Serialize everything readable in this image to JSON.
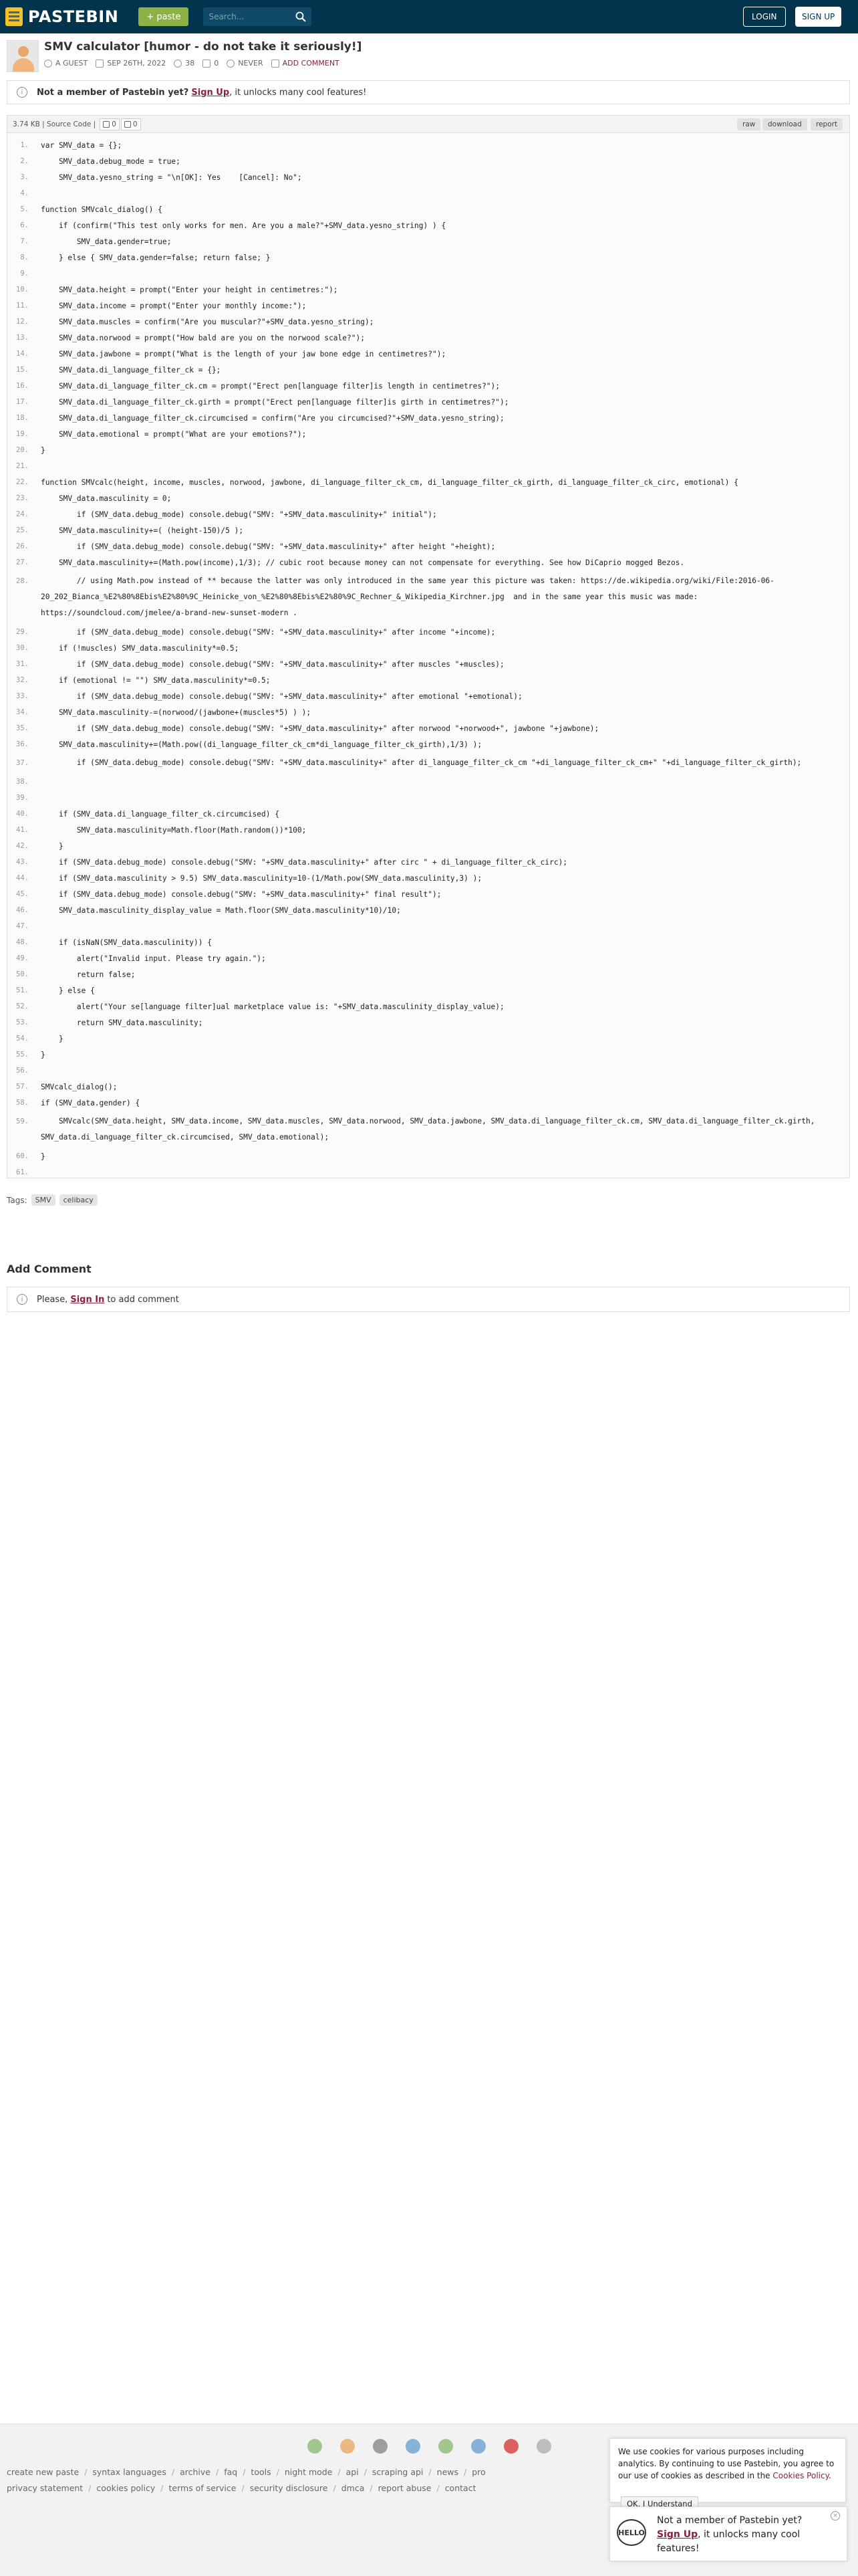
{
  "header": {
    "logo_text": "PASTEBIN",
    "paste_button": "+ paste",
    "search_placeholder": "Search...",
    "login": "LOGIN",
    "signup": "SIGN UP"
  },
  "paste": {
    "title": "SMV calculator [humor - do not take it seriously!]",
    "author": "A GUEST",
    "date": "SEP 26TH, 2022",
    "views": "38",
    "comments": "0",
    "expire": "NEVER",
    "add_comment": "ADD COMMENT"
  },
  "notice": {
    "bold_text": "Not a member of Pastebin yet?",
    "link": "Sign Up",
    "rest": ", it unlocks many cool features!"
  },
  "code_header": {
    "size": "3.74 KB",
    "separator1": "|",
    "type": "Source Code",
    "separator2": "|",
    "likes": "0",
    "dislikes": "0",
    "raw": "raw",
    "download": "download",
    "report": "report"
  },
  "code_lines": [
    {
      "n": "1.",
      "t": "var SMV_data = {};"
    },
    {
      "n": "2.",
      "t": "    SMV_data.debug_mode = true;"
    },
    {
      "n": "3.",
      "t": "    SMV_data.yesno_string = \"\\n[OK]: Yes    [Cancel]: No\";"
    },
    {
      "n": "4.",
      "t": ""
    },
    {
      "n": "5.",
      "t": "function SMVcalc_dialog() {"
    },
    {
      "n": "6.",
      "t": "    if (confirm(\"This test only works for men. Are you a male?\"+SMV_data.yesno_string) ) {"
    },
    {
      "n": "7.",
      "t": "        SMV_data.gender=true;"
    },
    {
      "n": "8.",
      "t": "    } else { SMV_data.gender=false; return false; }"
    },
    {
      "n": "9.",
      "t": ""
    },
    {
      "n": "10.",
      "t": "    SMV_data.height = prompt(\"Enter your height in centimetres:\");"
    },
    {
      "n": "11.",
      "t": "    SMV_data.income = prompt(\"Enter your monthly income:\");"
    },
    {
      "n": "12.",
      "t": "    SMV_data.muscles = confirm(\"Are you muscular?\"+SMV_data.yesno_string);"
    },
    {
      "n": "13.",
      "t": "    SMV_data.norwood = prompt(\"How bald are you on the norwood scale?\");"
    },
    {
      "n": "14.",
      "t": "    SMV_data.jawbone = prompt(\"What is the length of your jaw bone edge in centimetres?\");"
    },
    {
      "n": "15.",
      "t": "    SMV_data.di_language_filter_ck = {};"
    },
    {
      "n": "16.",
      "t": "    SMV_data.di_language_filter_ck.cm = prompt(\"Erect pen[language filter]is length in centimetres?\");"
    },
    {
      "n": "17.",
      "t": "    SMV_data.di_language_filter_ck.girth = prompt(\"Erect pen[language filter]is girth in centimetres?\");"
    },
    {
      "n": "18.",
      "t": "    SMV_data.di_language_filter_ck.circumcised = confirm(\"Are you circumcised?\"+SMV_data.yesno_string);"
    },
    {
      "n": "19.",
      "t": "    SMV_data.emotional = prompt(\"What are your emotions?\");"
    },
    {
      "n": "20.",
      "t": "}"
    },
    {
      "n": "21.",
      "t": ""
    },
    {
      "n": "22.",
      "t": "function SMVcalc(height, income, muscles, norwood, jawbone, di_language_filter_ck_cm, di_language_filter_ck_girth, di_language_filter_ck_circ, emotional) {"
    },
    {
      "n": "23.",
      "t": "    SMV_data.masculinity = 0;"
    },
    {
      "n": "24.",
      "t": "        if (SMV_data.debug_mode) console.debug(\"SMV: \"+SMV_data.masculinity+\" initial\");"
    },
    {
      "n": "25.",
      "t": "    SMV_data.masculinity+=( (height-150)/5 );"
    },
    {
      "n": "26.",
      "t": "        if (SMV_data.debug_mode) console.debug(\"SMV: \"+SMV_data.masculinity+\" after height \"+height);"
    },
    {
      "n": "27.",
      "t": "    SMV_data.masculinity+=(Math.pow(income),1/3); // cubic root because money can not compensate for everything. See how DiCaprio mogged Bezos."
    },
    {
      "n": "28.",
      "t": "        // using Math.pow instead of ** because the latter was only introduced in the same year this picture was taken: https://de.wikipedia.org/wiki/File:2016-06-20_202_Bianca_%E2%80%8Ebis%E2%80%9C_Heinicke_von_%E2%80%8Ebis%E2%80%9C_Rechner_&_Wikipedia_Kirchner.jpg  and in the same year this music was made: https://soundcloud.com/jmelee/a-brand-new-sunset-modern .",
      "wrap": true
    },
    {
      "n": "29.",
      "t": "        if (SMV_data.debug_mode) console.debug(\"SMV: \"+SMV_data.masculinity+\" after income \"+income);"
    },
    {
      "n": "30.",
      "t": "    if (!muscles) SMV_data.masculinity*=0.5;"
    },
    {
      "n": "31.",
      "t": "        if (SMV_data.debug_mode) console.debug(\"SMV: \"+SMV_data.masculinity+\" after muscles \"+muscles);"
    },
    {
      "n": "32.",
      "t": "    if (emotional != \"\") SMV_data.masculinity*=0.5;"
    },
    {
      "n": "33.",
      "t": "        if (SMV_data.debug_mode) console.debug(\"SMV: \"+SMV_data.masculinity+\" after emotional \"+emotional);"
    },
    {
      "n": "34.",
      "t": "    SMV_data.masculinity-=(norwood/(jawbone+(muscles*5) ) );"
    },
    {
      "n": "35.",
      "t": "        if (SMV_data.debug_mode) console.debug(\"SMV: \"+SMV_data.masculinity+\" after norwood \"+norwood+\", jawbone \"+jawbone);"
    },
    {
      "n": "36.",
      "t": "    SMV_data.masculinity+=(Math.pow((di_language_filter_ck_cm*di_language_filter_ck_girth),1/3) );"
    },
    {
      "n": "37.",
      "t": "        if (SMV_data.debug_mode) console.debug(\"SMV: \"+SMV_data.masculinity+\" after di_language_filter_ck_cm \"+di_language_filter_ck_cm+\" \"+di_language_filter_ck_girth);",
      "wrap": true
    },
    {
      "n": "38.",
      "t": ""
    },
    {
      "n": "39.",
      "t": ""
    },
    {
      "n": "40.",
      "t": "    if (SMV_data.di_language_filter_ck.circumcised) {"
    },
    {
      "n": "41.",
      "t": "        SMV_data.masculinity=Math.floor(Math.random())*100;"
    },
    {
      "n": "42.",
      "t": "    }"
    },
    {
      "n": "43.",
      "t": "    if (SMV_data.debug_mode) console.debug(\"SMV: \"+SMV_data.masculinity+\" after circ \" + di_language_filter_ck_circ);"
    },
    {
      "n": "44.",
      "t": "    if (SMV_data.masculinity > 9.5) SMV_data.masculinity=10-(1/Math.pow(SMV_data.masculinity,3) );"
    },
    {
      "n": "45.",
      "t": "    if (SMV_data.debug_mode) console.debug(\"SMV: \"+SMV_data.masculinity+\" final result\");"
    },
    {
      "n": "46.",
      "t": "    SMV_data.masculinity_display_value = Math.floor(SMV_data.masculinity*10)/10;"
    },
    {
      "n": "47.",
      "t": ""
    },
    {
      "n": "48.",
      "t": "    if (isNaN(SMV_data.masculinity)) {"
    },
    {
      "n": "49.",
      "t": "        alert(\"Invalid input. Please try again.\");"
    },
    {
      "n": "50.",
      "t": "        return false;"
    },
    {
      "n": "51.",
      "t": "    } else {"
    },
    {
      "n": "52.",
      "t": "        alert(\"Your se[language filter]ual marketplace value is: \"+SMV_data.masculinity_display_value);"
    },
    {
      "n": "53.",
      "t": "        return SMV_data.masculinity;"
    },
    {
      "n": "54.",
      "t": "    }"
    },
    {
      "n": "55.",
      "t": "}"
    },
    {
      "n": "56.",
      "t": ""
    },
    {
      "n": "57.",
      "t": "SMVcalc_dialog();"
    },
    {
      "n": "58.",
      "t": "if (SMV_data.gender) {"
    },
    {
      "n": "59.",
      "t": "    SMVcalc(SMV_data.height, SMV_data.income, SMV_data.muscles, SMV_data.norwood, SMV_data.jawbone, SMV_data.di_language_filter_ck.cm, SMV_data.di_language_filter_ck.girth, SMV_data.di_language_filter_ck.circumcised, SMV_data.emotional);",
      "wrap": true
    },
    {
      "n": "60.",
      "t": "}"
    },
    {
      "n": "61.",
      "t": ""
    }
  ],
  "tags": {
    "label": "Tags:",
    "items": [
      "SMV",
      "celibacy"
    ]
  },
  "comments": {
    "heading": "Add Comment",
    "prompt_before": "Please,",
    "link": "Sign In",
    "prompt_after": "to add comment"
  },
  "footer": {
    "row1": [
      "create new paste",
      "syntax languages",
      "archive",
      "faq",
      "tools",
      "night mode",
      "api",
      "scraping api",
      "news",
      "pro"
    ],
    "row2": [
      "privacy statement",
      "cookies policy",
      "terms of service",
      "security disclosure",
      "dmca",
      "report abuse",
      "contact"
    ]
  },
  "cookie_banner": {
    "text": "We use cookies for various purposes including analytics. By continuing to use Pastebin, you agree to our use of cookies as described in the",
    "link": "Cookies Policy",
    "ok": "OK, I Understand"
  },
  "promo": {
    "bubble": "HELLO",
    "text1": "Not a member of Pastebin yet?",
    "link": "Sign Up",
    "text2": ", it unlocks many cool features!"
  }
}
